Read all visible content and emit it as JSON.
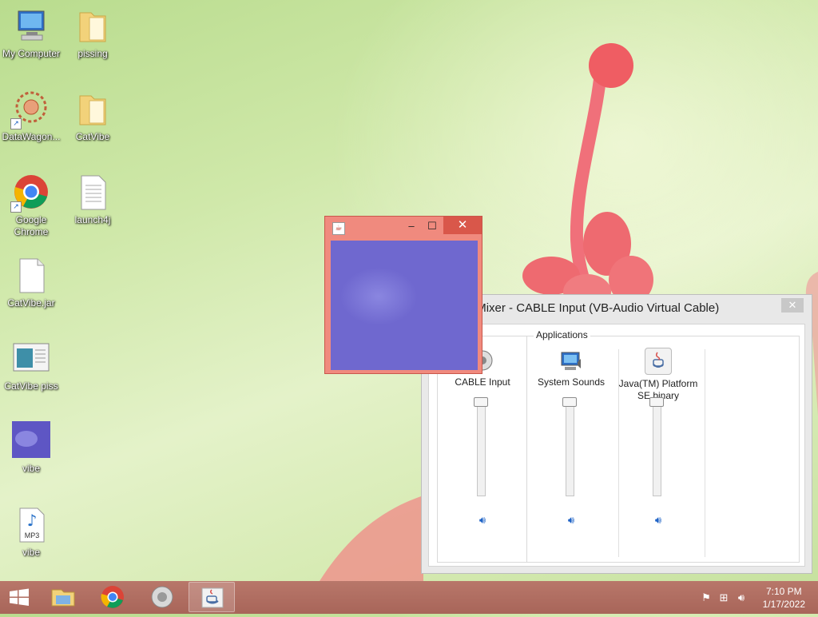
{
  "desktop": {
    "icons": [
      {
        "label": "My Computer",
        "icon": "computer-icon"
      },
      {
        "label": "pissing",
        "icon": "folder-icon"
      },
      {
        "label": "DataWagon...",
        "icon": "datawagon-icon"
      },
      {
        "label": "CatVibe",
        "icon": "folder-icon"
      },
      {
        "label": "Google Chrome",
        "icon": "chrome-icon"
      },
      {
        "label": "launch4j",
        "icon": "text-file-icon"
      },
      {
        "label": "CatVibe.jar",
        "icon": "file-icon"
      },
      {
        "label": "CatVibe piss",
        "icon": "screenshot-icon"
      },
      {
        "label": "vibe",
        "icon": "video-thumbnail-icon"
      },
      {
        "label": "vibe",
        "icon": "mp3-file-icon"
      }
    ]
  },
  "video_window": {
    "minimize": "–",
    "maximize": "☐",
    "close": "✕"
  },
  "mixer": {
    "title": "Volume Mixer - CABLE Input (VB-Audio Virtual Cable)",
    "close": "✕",
    "applications_label": "Applications",
    "device": {
      "label": "CABLE Input",
      "level": 1.0
    },
    "apps": [
      {
        "label": "System Sounds",
        "level": 1.0
      },
      {
        "label": "Java(TM) Platform SE binary",
        "level": 1.0
      }
    ]
  },
  "taskbar": {
    "clock_time": "7:10 PM",
    "clock_date": "1/17/2022"
  },
  "colors": {
    "taskbar": "#a86559",
    "video_titlebar": "#f08a7e",
    "video_close": "#d9574a",
    "mute_icon": "#1f63c6"
  }
}
